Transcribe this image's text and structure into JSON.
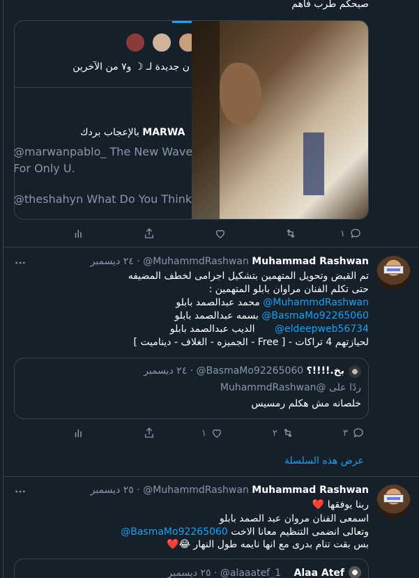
{
  "top_snippet": "صيحكم طرب فاهم",
  "quoted_card": {
    "members_line": "ن جديدة لـ ☽ و٧ من الآخرين",
    "like_line_name": "MARWA",
    "like_line_rest": "بالإعجاب بردك",
    "line1": "@marwanpablo_  The New Wave",
    "line2": "For Only U.",
    "line3": "@theshahyn  What Do You Think !"
  },
  "tweet1_actions": {
    "reply": "١",
    "retweet": "",
    "like": ""
  },
  "tweet2": {
    "name": "Muhammad Rashwan",
    "handle": "@MuhammdRashwan",
    "date": "· ٢٤ ديسمبر",
    "text_line1": "تم القبض وتحويل المتهمين بتشكيل اجرامى لخطف المضيفه",
    "text_line2": "حتى تكلم الفنان مراوان بابلو المتهمين :",
    "mention1": "@MuhammdRashwan",
    "mention1_text": "محمد عبدالصمد بابلو",
    "mention2": "@BasmaMo92265060",
    "mention2_text": "بسمه عبدالصمد بابلو",
    "mention3": "@eldeepweb56734",
    "mention3_text": "الديب عبدالصمد بابلو",
    "text_line6": "لحيازتهم 4 تراكات - [ Free - الجميزه - الغلاف - ديناميت ]",
    "quote": {
      "name": "بخ.!!!!؟",
      "handle": "@BasmaMo92265060",
      "date": "· ٢٤ ديسمبر",
      "reply_to": "ردًا على @MuhammdRashwan",
      "text": "خلصانه مش هكلم رمسيس"
    },
    "actions": {
      "reply": "٣",
      "retweet": "٢",
      "like": "١"
    }
  },
  "show_thread": "عرض هذه السلسلة",
  "tweet3": {
    "name": "Muhammad Rashwan",
    "handle": "@MuhammdRashwan",
    "date": "· ٢٥ ديسمبر",
    "line1": "ربنا يوفقها ❤️",
    "line2": "اسمعى الفنان مروان عبد الصمد بابلو",
    "line3_text": "وتعالى انضمى التنظيم معانا الاخت",
    "line3_mention": "@BasmaMo92265060",
    "line4": "بس بقت تنام بدرى مع انها نايمه طول النهار 😂❤️",
    "quote": {
      "name": "Alaa Atef",
      "handle": "@alaaatef_1",
      "date": "· ٢٥ ديسمبر"
    }
  },
  "colors": {
    "background": "#15202b",
    "border": "#38444d",
    "muted": "#8899a6",
    "link": "#1da1f2"
  }
}
